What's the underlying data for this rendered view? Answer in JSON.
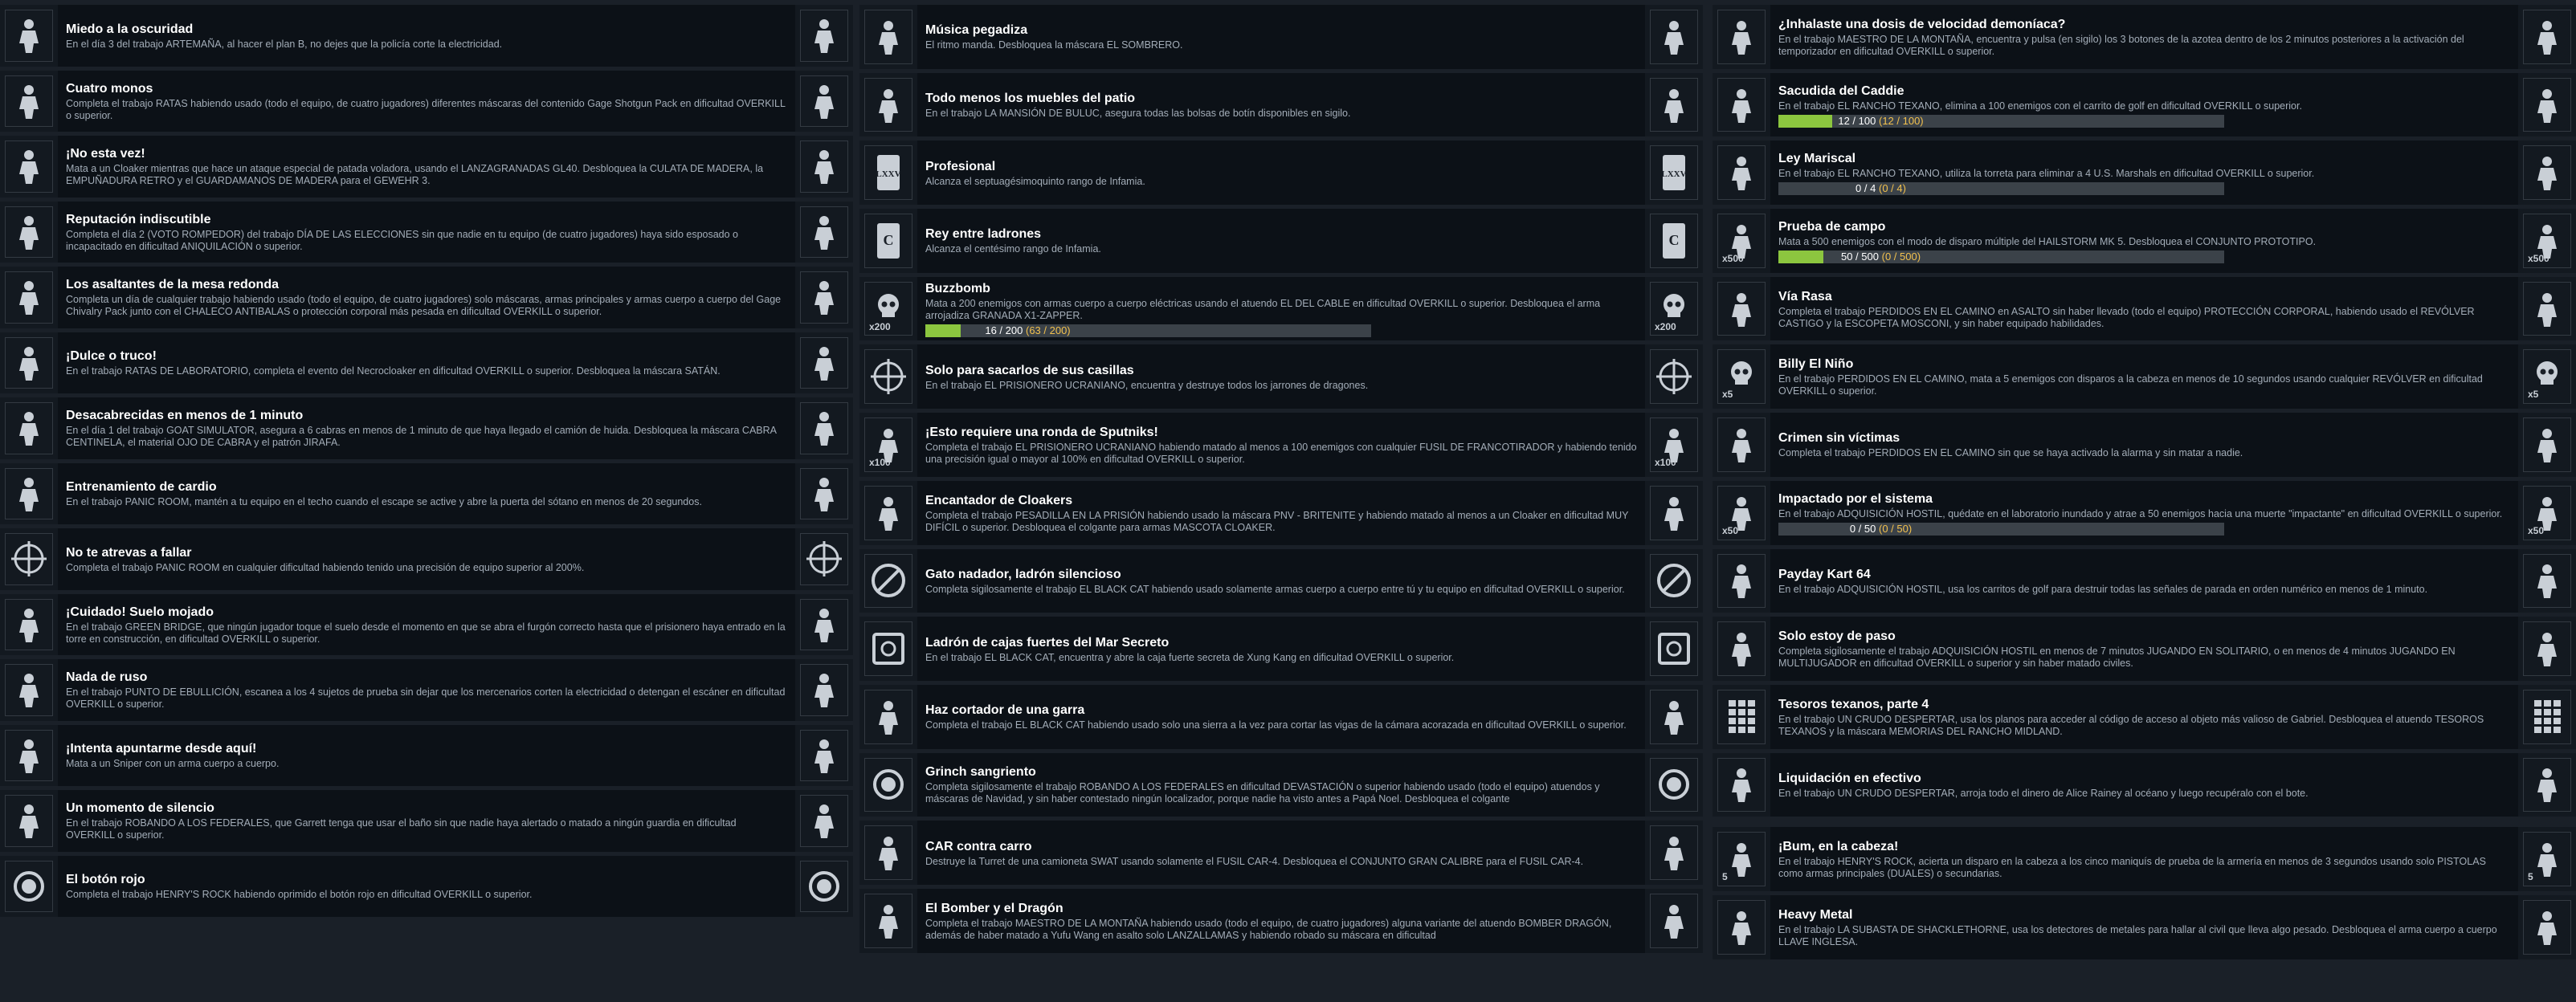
{
  "columns": [
    {
      "rows": [
        {
          "title": "Miedo a la oscuridad",
          "desc": "En el día 3 del trabajo ARTEMAÑA, al hacer el plan B, no dejes que la policía corte la electricidad.",
          "icon": "scared-face-icon"
        },
        {
          "title": "Cuatro monos",
          "desc": "Completa el trabajo RATAS habiendo usado (todo el equipo, de cuatro jugadores) diferentes máscaras del contenido Gage Shotgun Pack en dificultad OVERKILL o superior.",
          "icon": "monkey-ring-icon"
        },
        {
          "title": "¡No esta vez!",
          "desc": "Mata a un Cloaker mientras que hace un ataque especial de patada voladora, usando el LANZAGRANADAS GL40. Desbloquea la CULATA DE MADERA, la EMPUÑADURA RETRO y el GUARDAMANOS DE MADERA para el GEWEHR 3.",
          "icon": "flying-kick-icon"
        },
        {
          "title": "Reputación indiscutible",
          "desc": "Completa el día 2 (VOTO ROMPEDOR) del trabajo DÍA DE LAS ELECCIONES sin que nadie en tu equipo (de cuatro jugadores) haya sido esposado o incapacitado en dificultad ANIQUILACIÓN o superior.",
          "icon": "ballot-box-icon"
        },
        {
          "title": "Los asaltantes de la mesa redonda",
          "desc": "Completa un día de cualquier trabajo habiendo usado (todo el equipo, de cuatro jugadores) solo máscaras, armas principales y armas cuerpo a cuerpo del Gage Chivalry Pack junto con el CHALECO ANTIBALAS o protección corporal más pesada en dificultad OVERKILL o superior.",
          "icon": "knight-helmet-icon"
        },
        {
          "title": "¡Dulce o truco!",
          "desc": "En el trabajo RATAS DE LABORATORIO, completa el evento del Necrocloaker en dificultad OVERKILL o superior. Desbloquea la máscara SATÁN.",
          "icon": "demon-mask-icon"
        },
        {
          "title": "Desacabrecidas en menos de 1 minuto",
          "desc": "En el día 1 del trabajo GOAT SIMULATOR, asegura a 6 cabras en menos de 1 minuto de que haya llegado el camión de huida. Desbloquea la máscara CABRA CENTINELA, el material OJO DE CABRA y el patrón JIRAFA.",
          "icon": "goat-head-icon"
        },
        {
          "title": "Entrenamiento de cardio",
          "desc": "En el trabajo PANIC ROOM, mantén a tu equipo en el techo cuando el escape se active y abre la puerta del sótano en menos de 20 segundos.",
          "icon": "building-icon"
        },
        {
          "title": "No te atrevas a fallar",
          "desc": "Completa el trabajo PANIC ROOM en cualquier dificultad habiendo tenido una precisión de equipo superior al 200%.",
          "icon": "crosshair-icon"
        },
        {
          "title": "¡Cuidado! Suelo mojado",
          "desc": "En el trabajo GREEN BRIDGE, que ningún jugador toque el suelo desde el momento en que se abra el furgón correcto hasta que el prisionero haya entrado en la torre en construcción, en dificultad OVERKILL o superior.",
          "icon": "running-man-icon"
        },
        {
          "title": "Nada de ruso",
          "desc": "En el trabajo PUNTO DE EBULLICIÓN, escanea a los 4 sujetos de prueba sin dejar que los mercenarios corten la electricidad o detengan el escáner en dificultad OVERKILL o superior.",
          "icon": "scanner-x4-icon"
        },
        {
          "title": "¡Intenta apuntarme desde aquí!",
          "desc": "Mata a un Sniper con un arma cuerpo a cuerpo.",
          "icon": "melee-figure-icon"
        },
        {
          "title": "Un momento de silencio",
          "desc": "En el trabajo ROBANDO A LOS FEDERALES, que Garrett tenga que usar el baño sin que nadie haya alertado o matado a ningún guardia en dificultad OVERKILL o superior.",
          "icon": "toilet-stall-icon"
        },
        {
          "title": "El botón rojo",
          "desc": "Completa el trabajo HENRY'S ROCK habiendo oprimido el botón rojo en dificultad OVERKILL o superior.",
          "icon": "red-button-icon"
        }
      ]
    },
    {
      "rows": [
        {
          "title": "Música pegadiza",
          "desc": "El ritmo manda. Desbloquea la máscara EL SOMBRERO.",
          "icon": "music-guitar-icon"
        },
        {
          "title": "Todo menos los muebles del patio",
          "desc": "En el trabajo LA MANSIÓN DE BULUC, asegura todas las bolsas de botín disponibles en sigilo.",
          "icon": "carrying-bag-icon"
        },
        {
          "title": "Profesional",
          "desc": "Alcanza el septuagésimoquinto rango de Infamia.",
          "icon": "card-lxxv-icon",
          "card": "LXXV"
        },
        {
          "title": "Rey entre ladrones",
          "desc": "Alcanza el centésimo rango de Infamia.",
          "icon": "card-c-icon",
          "card": "C"
        },
        {
          "title": "Buzzbomb",
          "desc": "Mata a 200 enemigos con armas cuerpo a cuerpo eléctricas usando el atuendo EL DEL CABLE en dificultad OVERKILL o superior. Desbloquea el arma arrojadiza GRANADA X1-ZAPPER.",
          "icon": "skull-x200-icon",
          "badge": "x200",
          "progress": {
            "current": "16",
            "total": "200",
            "paren": "(63 / 200)",
            "fraction": 0.08
          }
        },
        {
          "title": "Solo para sacarlos de sus casillas",
          "desc": "En el trabajo EL PRISIONERO UCRANIANO, encuentra y destruye todos los jarrones de dragones.",
          "icon": "crosshair-icon"
        },
        {
          "title": "¡Esto requiere una ronda de Sputniks!",
          "desc": "Completa el trabajo EL PRISIONERO UCRANIANO habiendo matado al menos a 100 enemigos con cualquier FUSIL DE FRANCOTIRADOR y habiendo tenido una precisión igual o mayor al 100% en dificultad OVERKILL o superior.",
          "icon": "sniper-x100-icon",
          "badge": "x100"
        },
        {
          "title": "Encantador de Cloakers",
          "desc": "Completa el trabajo PESADILLA EN LA PRISIÓN habiendo usado la máscara PNV - BRITENITE y habiendo matado al menos a un Cloaker en dificultad MUY DIFÍCIL o superior. Desbloquea el colgante para armas MASCOTA CLOAKER.",
          "icon": "cloaker-goggles-icon"
        },
        {
          "title": "Gato nadador, ladrón silencioso",
          "desc": "Completa sigilosamente el trabajo EL BLACK CAT habiendo usado solamente armas cuerpo a cuerpo entre tú y tu equipo en dificultad OVERKILL o superior.",
          "icon": "no-gun-icon"
        },
        {
          "title": "Ladrón de cajas fuertes del Mar Secreto",
          "desc": "En el trabajo EL BLACK CAT, encuentra y abre la caja fuerte secreta de Xung Kang en dificultad OVERKILL o superior.",
          "icon": "safe-icon"
        },
        {
          "title": "Haz cortador de una garra",
          "desc": "Completa el trabajo EL BLACK CAT habiendo usado solo una sierra a la vez para cortar las vigas de la cámara acorazada en dificultad OVERKILL o superior.",
          "icon": "saw-blade-icon"
        },
        {
          "title": "Grinch sangriento",
          "desc": "Completa sigilosamente el trabajo ROBANDO A LOS FEDERALES en dificultad DEVASTACIÓN o superior habiendo usado (todo el equipo) atuendos y máscaras de Navidad, y sin haber contestado ningún localizador, porque nadie ha visto antes a Papá Noel. Desbloquea el colgante",
          "icon": "ornament-icon"
        },
        {
          "title": "CAR contra carro",
          "desc": "Destruye la Turret de una camioneta SWAT usando solamente el FUSIL CAR-4. Desbloquea el CONJUNTO GRAN CALIBRE para el FUSIL CAR-4.",
          "icon": "armored-truck-icon"
        },
        {
          "title": "El Bomber y el Dragón",
          "desc": "Completa el trabajo MAESTRO DE LA MONTAÑA habiendo usado (todo el equipo, de cuatro jugadores) alguna variante del atuendo BOMBER DRAGÓN, además de haber matado a Yufu Wang en asalto solo LANZALLAMAS y habiendo robado su máscara en dificultad",
          "icon": "flamethrower-icon"
        }
      ]
    },
    {
      "rows": [
        {
          "title": "¿Inhalaste una dosis de velocidad demoníaca?",
          "desc": "En el trabajo MAESTRO DE LA MONTAÑA, encuentra y pulsa (en sigilo) los 3 botones de la azotea dentro de los 2 minutos posteriores a la activación del temporizador en dificultad OVERKILL o superior.",
          "icon": "plunger-button-icon"
        },
        {
          "title": "Sacudida del Caddie",
          "desc": "En el trabajo EL RANCHO TEXANO, elimina a 100 enemigos con el carrito de golf en dificultad OVERKILL o superior.",
          "icon": "golf-cart-icon",
          "progress": {
            "current": "12",
            "total": "100",
            "paren": "(12 / 100)",
            "fraction": 0.12
          }
        },
        {
          "title": "Ley Mariscal",
          "desc": "En el trabajo EL RANCHO TEXANO, utiliza la torreta para eliminar a 4 U.S. Marshals en dificultad OVERKILL o superior.",
          "icon": "four-figures-icon",
          "progress": {
            "current": "0",
            "total": "4",
            "paren": "(0 / 4)",
            "fraction": 0
          }
        },
        {
          "title": "Prueba de campo",
          "desc": "Mata a 500 enemigos con el modo de disparo múltiple del HAILSTORM MK 5. Desbloquea el CONJUNTO PROTOTIPO.",
          "icon": "gun-x500-icon",
          "badge": "x500",
          "progress": {
            "current": "50",
            "total": "500",
            "paren": "(0 / 500)",
            "fraction": 0.1
          }
        },
        {
          "title": "Vía Rasa",
          "desc": "Completa el trabajo PERDIDOS EN EL CAMINO en ASALTO sin haber llevado (todo el equipo) PROTECCIÓN CORPORAL, habiendo usado el REVÓLVER CASTIGO y la ESCOPETA MOSCONI, y sin haber equipado habilidades.",
          "icon": "cowboy-figure-icon"
        },
        {
          "title": "Billy El Niño",
          "desc": "En el trabajo PERDIDOS EN EL CAMINO, mata a 5 enemigos con disparos a la cabeza en menos de 10 segundos usando cualquier REVÓLVER en dificultad OVERKILL o superior.",
          "icon": "skull-x5-icon",
          "badge": "x5"
        },
        {
          "title": "Crimen sin víctimas",
          "desc": "Completa el trabajo PERDIDOS EN EL CAMINO sin que se haya activado la alarma y sin matar a nadie.",
          "icon": "rocket-icon"
        },
        {
          "title": "Impactado por el sistema",
          "desc": "En el trabajo ADQUISICIÓN HOSTIL, quédate en el laboratorio inundado y atrae a 50 enemigos hacia una muerte \"impactante\" en dificultad OVERKILL o superior.",
          "icon": "shock-x50-icon",
          "badge": "x50",
          "progress": {
            "current": "0",
            "total": "50",
            "paren": "(0 / 50)",
            "fraction": 0
          }
        },
        {
          "title": "Payday Kart 64",
          "desc": "En el trabajo ADQUISICIÓN HOSTIL, usa los carritos de golf para destruir todas las señales de parada en orden numérico en menos de 1 minuto.",
          "icon": "kart-icon"
        },
        {
          "title": "Solo estoy de paso",
          "desc": "Completa sigilosamente el trabajo ADQUISICIÓN HOSTIL en menos de 7 minutos JUGANDO EN SOLITARIO, o en menos de 4 minutos JUGANDO EN MULTIJUGADOR en dificultad OVERKILL o superior y sin haber matado civiles.",
          "icon": "sneaking-figure-icon"
        },
        {
          "title": "Tesoros texanos, parte 4",
          "desc": "En el trabajo UN CRUDO DESPERTAR, usa los planos para acceder al código de acceso al objeto más valioso de Gabriel. Desbloquea el atuendo TESOROS TEXANOS y la máscara MEMORIAS DEL RANCHO MIDLAND.",
          "icon": "keypad-icon"
        },
        {
          "title": "Liquidación en efectivo",
          "desc": "En el trabajo UN CRUDO DESPERTAR, arroja todo el dinero de Alice Rainey al océano y luego recupéralo con el bote.",
          "icon": "money-toss-icon"
        },
        {
          "title": "¡Bum, en la cabeza!",
          "desc": "En el trabajo HENRY'S ROCK, acierta un disparo en la cabeza a los cinco maniquís de prueba de la armería en menos de 3 segundos usando solo PISTOLAS como armas principales (DUALES) o secundarias.",
          "icon": "head-timer-icon",
          "badge": "5"
        },
        {
          "title": "Heavy Metal",
          "desc": "En el trabajo LA SUBASTA DE SHACKLETHORNE, usa los detectores de metales para hallar al civil que lleva algo pesado. Desbloquea el arma cuerpo a cuerpo LLAVE INGLESA.",
          "icon": "metal-detector-icon"
        }
      ]
    }
  ]
}
